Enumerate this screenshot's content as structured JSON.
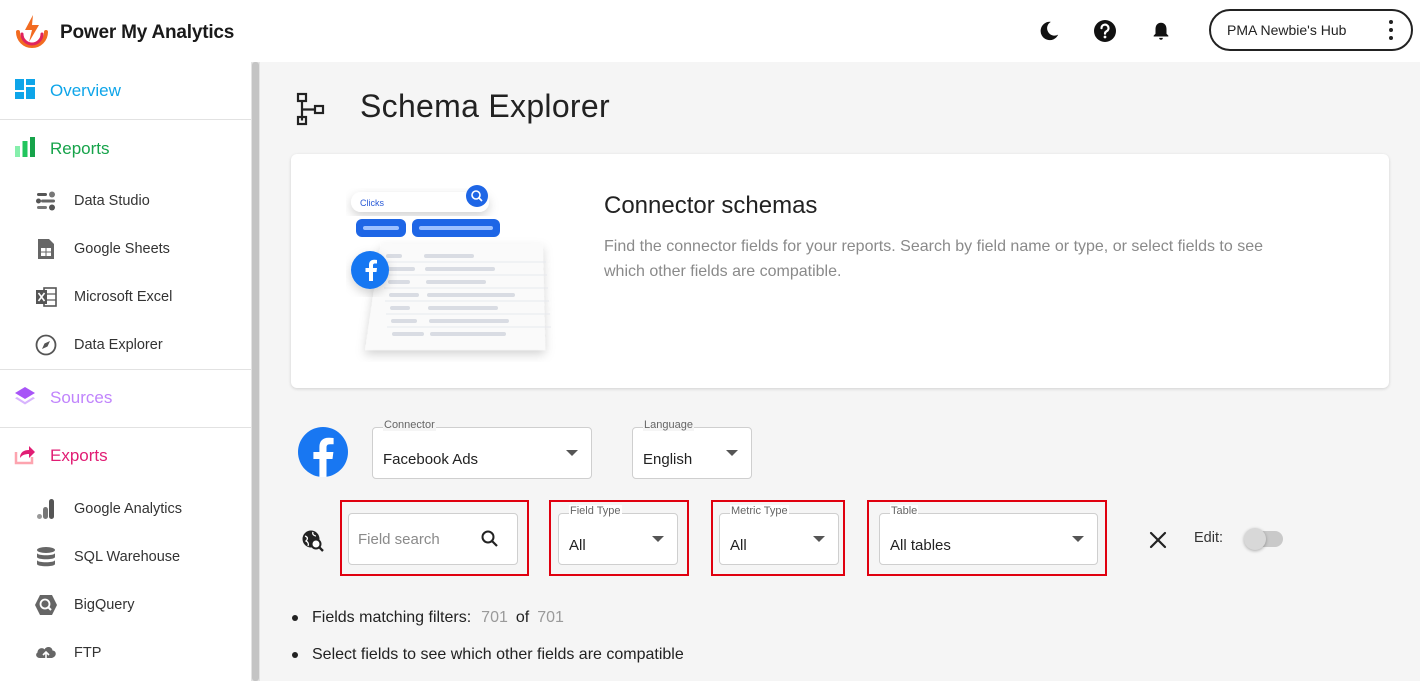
{
  "header": {
    "brand": "Power My Analytics",
    "theme_icon": "moon-icon",
    "help_icon": "help-circle-icon",
    "notifications_icon": "bell-icon",
    "account_label": "PMA Newbie's Hub",
    "account_menu_icon": "more-vertical-icon"
  },
  "sidebar": {
    "overview": {
      "label": "Overview",
      "icon": "dashboard-icon",
      "color": "#0ea5e9"
    },
    "reports": {
      "label": "Reports",
      "icon": "bar-chart-icon",
      "color": "#16a34a",
      "items": [
        {
          "label": "Data Studio",
          "icon": "data-studio-icon"
        },
        {
          "label": "Google Sheets",
          "icon": "google-sheets-icon"
        },
        {
          "label": "Microsoft Excel",
          "icon": "microsoft-excel-icon"
        },
        {
          "label": "Data Explorer",
          "icon": "compass-icon"
        }
      ]
    },
    "sources": {
      "label": "Sources",
      "icon": "layers-icon",
      "color": "#c084fc"
    },
    "exports": {
      "label": "Exports",
      "icon": "export-icon",
      "color": "#e11d74",
      "items": [
        {
          "label": "Google Analytics",
          "icon": "google-analytics-icon"
        },
        {
          "label": "SQL Warehouse",
          "icon": "database-icon"
        },
        {
          "label": "BigQuery",
          "icon": "bigquery-icon"
        },
        {
          "label": "FTP",
          "icon": "ftp-cloud-icon"
        }
      ]
    }
  },
  "main": {
    "title": "Schema Explorer",
    "title_icon": "schema-tree-icon",
    "card": {
      "title": "Connector schemas",
      "description": "Find the connector fields for your reports. Search by field name or type, or select fields to see which other fields are compatible.",
      "illustration_search_text": "Clicks"
    },
    "connector": {
      "label": "Connector",
      "value": "Facebook Ads",
      "logo": "facebook-icon"
    },
    "language": {
      "label": "Language",
      "value": "English"
    },
    "filters": {
      "field_search_placeholder": "Field search",
      "field_type": {
        "label": "Field Type",
        "value": "All"
      },
      "metric_type": {
        "label": "Metric Type",
        "value": "All"
      },
      "table": {
        "label": "Table",
        "value": "All tables"
      },
      "clear_icon": "close-icon",
      "edit_label": "Edit:",
      "edit_enabled": false
    },
    "stats": {
      "matching_label": "Fields matching filters:",
      "matching_count": "701",
      "of_label": "of",
      "total_count": "701",
      "hint": "Select fields to see which other fields are compatible"
    }
  },
  "colors": {
    "highlight_box": "#e0000f",
    "facebook_blue": "#1877f2"
  }
}
